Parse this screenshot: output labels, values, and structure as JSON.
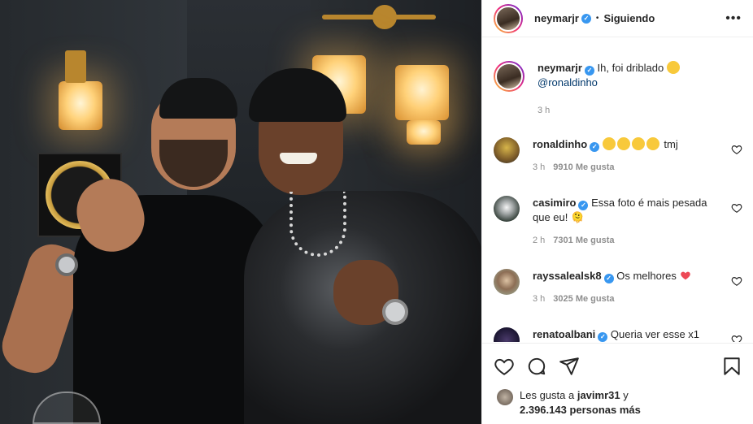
{
  "post": {
    "author": "neymarjr",
    "dot": "•",
    "follow_status": "Siguiendo",
    "more_glyph": "•••"
  },
  "caption": {
    "username": "neymarjr",
    "text": "Ih, foi driblado",
    "mention": "@ronaldinho",
    "time": "3 h"
  },
  "comments": [
    {
      "username": "ronaldinho",
      "text": "tmj",
      "emoji_count": 4,
      "time": "3 h",
      "likes": "9910 Me gusta"
    },
    {
      "username": "casimiro",
      "text_line1": "Essa foto é mais pesada",
      "text_line2": "que eu! 🫠",
      "time": "2 h",
      "likes": "7301 Me gusta"
    },
    {
      "username": "rayssalealsk8",
      "text": "Os melhores",
      "time": "3 h",
      "likes": "3025 Me gusta"
    },
    {
      "username": "renatoalbani",
      "text": "Queria ver esse x1"
    }
  ],
  "likes_summary": {
    "prefix": "Les gusta a",
    "user": "javimr31",
    "suffix": "y",
    "count": "2.396.143 personas más"
  },
  "icons": [
    "heart-icon",
    "comment-icon",
    "share-icon",
    "bookmark-icon",
    "verified-icon",
    "more-options-icon"
  ],
  "colors": {
    "verified": "#3897f0",
    "mention": "#00376b",
    "muted": "#8e8e8e",
    "heart_red": "#ed4956"
  }
}
